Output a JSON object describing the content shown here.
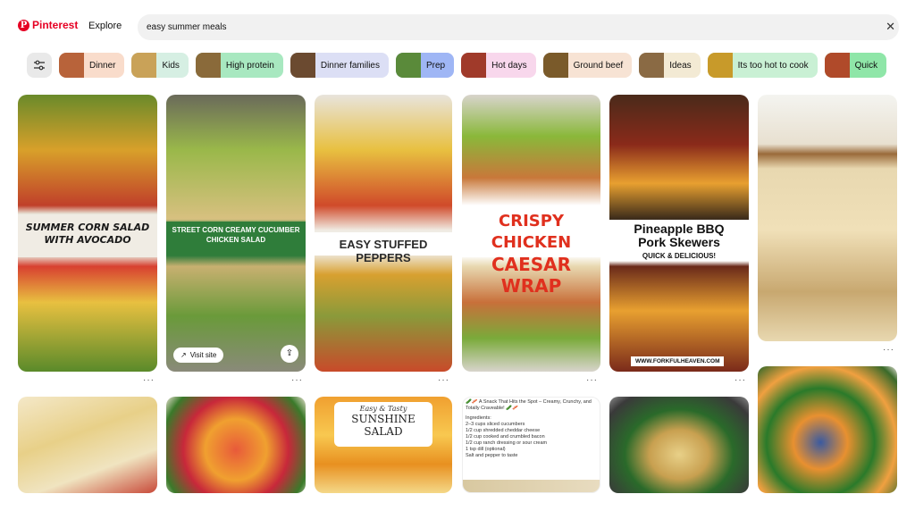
{
  "header": {
    "logo_text": "Pinterest",
    "explore_label": "Explore",
    "search_value": "easy summer meals"
  },
  "chips": [
    {
      "label": "Dinner",
      "color": "#f9dccb",
      "thumb": "#b8633a"
    },
    {
      "label": "Kids",
      "color": "#d6efe3",
      "thumb": "#c9a258"
    },
    {
      "label": "High protein",
      "color": "#a8e8c0",
      "thumb": "#8a6a3a"
    },
    {
      "label": "Dinner families",
      "color": "#dcdff5",
      "thumb": "#6b4a30"
    },
    {
      "label": "Prep",
      "color": "#9fb6f5",
      "thumb": "#5a8a3a"
    },
    {
      "label": "Hot days",
      "color": "#f8d7ec",
      "thumb": "#a03a2a"
    },
    {
      "label": "Ground beef",
      "color": "#f7e3d4",
      "thumb": "#7a5a2a"
    },
    {
      "label": "Ideas",
      "color": "#f3ead4",
      "thumb": "#8a6a44"
    },
    {
      "label": "Its too hot to cook",
      "color": "#c9f0d4",
      "thumb": "#c89a2a"
    },
    {
      "label": "Quick",
      "color": "#8fe6a8",
      "thumb": "#b04a2a"
    }
  ],
  "pins": {
    "corn_salad_title": "SUMMER CORN SALAD WITH AVOCADO",
    "street_corn_title": "STREET CORN CREAMY CUCUMBER CHICKEN SALAD",
    "visit_site_label": "Visit site",
    "stuffed_peppers_title": "EASY STUFFED PEPPERS",
    "caesar_wrap_line1": "CRISPY CHICKEN",
    "caesar_wrap_line2": "CAESAR WRAP",
    "skewers_line1": "Pineapple BBQ",
    "skewers_line2": "Pork Skewers",
    "skewers_line3": "QUICK & DELICIOUS!",
    "skewers_url": "WWW.FORKFULHEAVEN.COM",
    "sunshine_line1": "Easy & Tasty",
    "sunshine_line2": "SUNSHINE",
    "sunshine_line3": "SALAD",
    "snack_intro": "🥒🥓 A Snack That Hits the Spot – Creamy, Crunchy, and Totally Craveable! 🥒🥓",
    "snack_ingredients_label": "Ingredients:",
    "snack_items": [
      "2–3 cups sliced cucumbers",
      "1/2 cup shredded cheddar cheese",
      "1/2 cup cooked and crumbled bacon",
      "1/2 cup ranch dressing or sour cream",
      "1 tsp dill (optional)",
      "Salt and pepper to taste"
    ],
    "more_dots": "···"
  }
}
